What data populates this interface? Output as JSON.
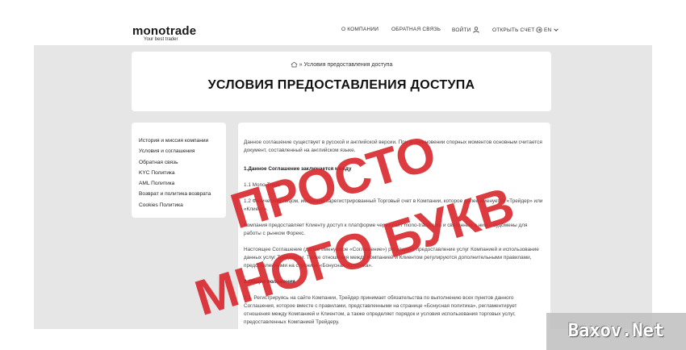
{
  "header": {
    "logo": "monotrade",
    "tagline": "Your best trader",
    "nav": {
      "about": "О КОМПАНИИ",
      "feedback": "ОБРАТНАЯ СВЯЗЬ",
      "login": "ВОЙТИ",
      "open_account": "ОТКРЫТЬ СЧЕТ",
      "language": "EN"
    }
  },
  "breadcrumb": "Условия предоставления доступа",
  "page_title": "УСЛОВИЯ ПРЕДОСТАВЛЕНИЯ ДОСТУПА",
  "sidebar": {
    "items": [
      "История и миссия компании",
      "Условия и соглашения",
      "Обратная связь",
      "KYC Политика",
      "AML Политика",
      "Возврат и политика возврата",
      "Cookies Политика"
    ]
  },
  "content": {
    "p1": "Данное соглашение существует в русской и английской версии. При возникновении спорных моментов основным считается документ, составленный на английском языке.",
    "h1": "1.Данное Соглашение заключается между",
    "p2": "1.1 Mono-Trade",
    "p3": "1.2 Физическим лицом, имеющим зарегистрированный Торговый счет в Компании, которое далее именуется «Трейдер» или «Клиент».",
    "p4": "Компания предоставляет Клиенту доступ к платформе через сайт mono-trade.com и связанные с ним – судомены для работы с рынком Форекс.",
    "p5": "Настоящее Соглашение (далее именуемое «Соглашение») регулирует предоставление услуг Компанией и использование данных услуг Трейдером. Также отношения между Компанией и Клиентом регулируются дополнительными правилами, представленными на странице «Бонусная политика».",
    "h2": "2.Общие положения",
    "p6": "2.1. Регистрируясь на сайте Компании, Трейдер принимает обязательства по выполнению всех пунктов данного Соглашения, которое вместе с правилами, представленными на странице «Бонусная политика», регламентирует отношения между Компанией и Клиентом, а также определяет порядок и условия использования торговых услуг, предоставленных Компанией Трейдеру."
  },
  "stamp": {
    "line1": "ПРОСТО",
    "line2": "МНОГО БУКВ",
    "color": "#d9262c"
  },
  "watermark": "Baxov.Net"
}
